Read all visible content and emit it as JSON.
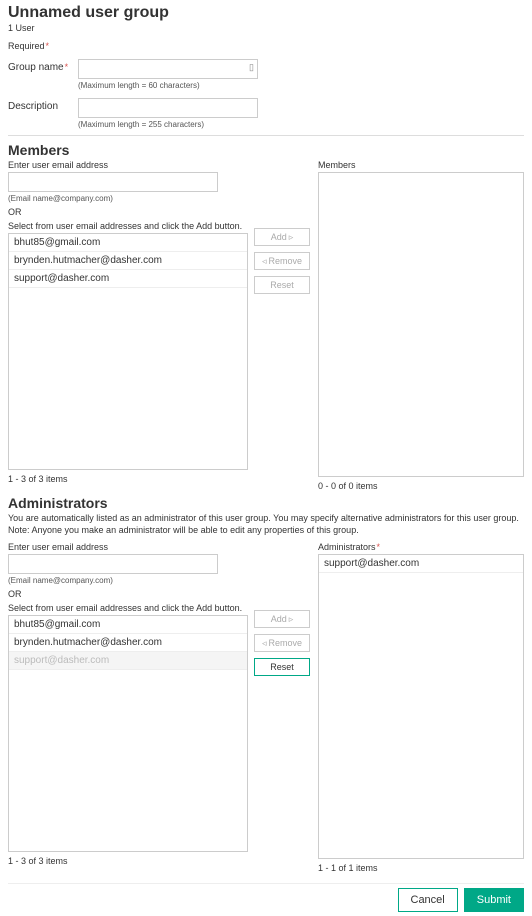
{
  "header": {
    "title": "Unnamed user group",
    "subtitle": "1 User",
    "required_label": "Required"
  },
  "fields": {
    "group_name_label": "Group name",
    "group_name_hint": "(Maximum length = 60 characters)",
    "description_label": "Description",
    "description_hint": "(Maximum length = 255 characters)"
  },
  "members": {
    "title": "Members",
    "enter_label": "Enter user email address",
    "email_hint": "(Email name@company.com)",
    "or_label": "OR",
    "select_label": "Select from user email addresses and click the Add button.",
    "items": [
      "bhut85@gmail.com",
      "brynden.hutmacher@dasher.com",
      "support@dasher.com"
    ],
    "left_count": "1 - 3 of 3 items",
    "right_label": "Members",
    "right_items": [],
    "right_count": "0 - 0 of 0 items",
    "buttons": {
      "add": "Add",
      "remove": "Remove",
      "reset": "Reset"
    }
  },
  "admins": {
    "title": "Administrators",
    "desc": "You are automatically listed as an administrator of this user group. You may specify alternative administrators for this user group. Note: Anyone you make an administrator will be able to edit any properties of this group.",
    "enter_label": "Enter user email address",
    "email_hint": "(Email name@company.com)",
    "or_label": "OR",
    "select_label": "Select from user email addresses and click the Add button.",
    "items": [
      {
        "text": "bhut85@gmail.com",
        "disabled": false
      },
      {
        "text": "brynden.hutmacher@dasher.com",
        "disabled": false
      },
      {
        "text": "support@dasher.com",
        "disabled": true
      }
    ],
    "left_count": "1 - 3 of 3 items",
    "right_label": "Administrators",
    "right_items": [
      "support@dasher.com"
    ],
    "right_count": "1 - 1 of 1 items",
    "buttons": {
      "add": "Add",
      "remove": "Remove",
      "reset": "Reset"
    }
  },
  "footer": {
    "cancel": "Cancel",
    "submit": "Submit"
  }
}
